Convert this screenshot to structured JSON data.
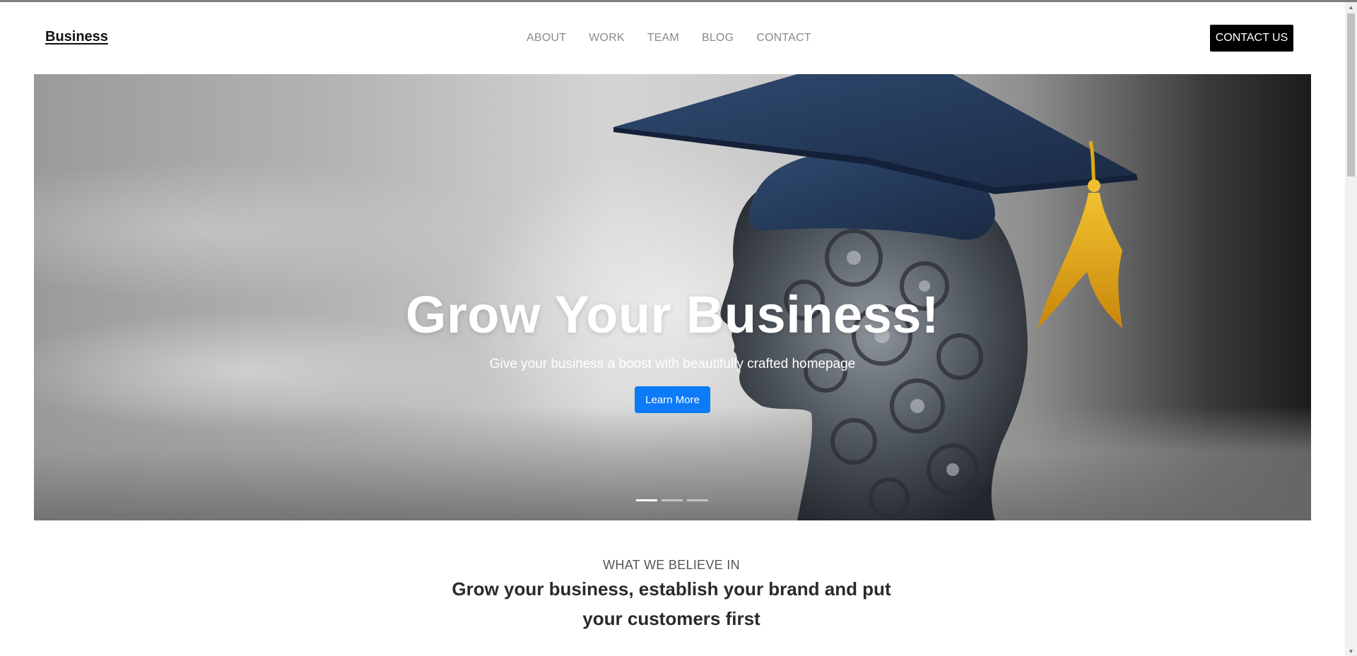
{
  "navbar": {
    "brand": "Business",
    "links": [
      "ABOUT",
      "WORK",
      "TEAM",
      "BLOG",
      "CONTACT"
    ],
    "cta": "CONTACT US"
  },
  "hero": {
    "title": "Grow Your Business!",
    "subtitle": "Give your business a boost with beautifully crafted homepage",
    "button": "Learn More",
    "slides_total": 3,
    "active_slide": 1
  },
  "belief": {
    "eyebrow": "WHAT WE BELIEVE IN",
    "heading": "Grow your business, establish your brand and put your customers first"
  },
  "colors": {
    "primary_button": "#0d7bf7",
    "contact_button": "#000000",
    "nav_text": "#8a8a8a"
  },
  "icons": {
    "scroll_up": "triangle-up",
    "scroll_down": "triangle-down"
  }
}
